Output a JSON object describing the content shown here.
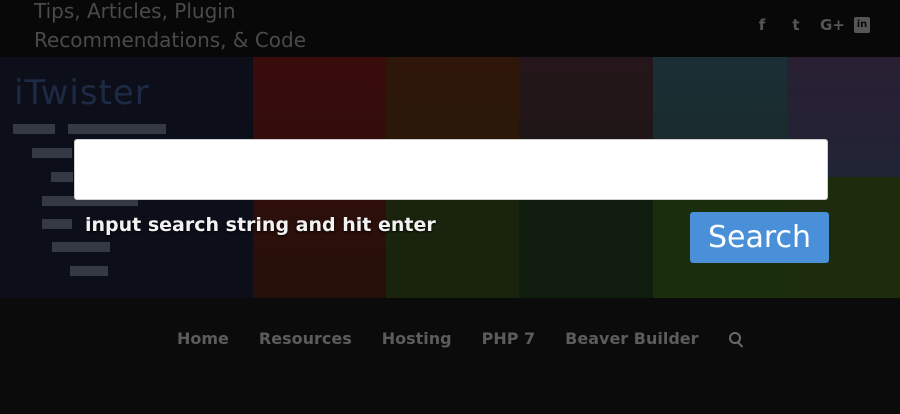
{
  "header": {
    "tagline": "Tips, Articles, Plugin Recommendations, & Code",
    "social": [
      {
        "name": "facebook-icon",
        "glyph": "f"
      },
      {
        "name": "twitter-icon",
        "glyph": "t"
      },
      {
        "name": "google-plus-icon",
        "glyph": "G+"
      },
      {
        "name": "linkedin-icon",
        "glyph": "in"
      }
    ]
  },
  "hero": {
    "logo_text": "iTwister"
  },
  "search": {
    "value": "",
    "placeholder": "",
    "hint": "input search string and hit enter",
    "button_label": "Search"
  },
  "nav": {
    "items": [
      "Home",
      "Resources",
      "Hosting",
      "PHP 7",
      "Beaver Builder"
    ],
    "search_icon": "search-icon"
  },
  "colors": {
    "accent": "#4a90d9",
    "background": "#0b0b0b"
  }
}
